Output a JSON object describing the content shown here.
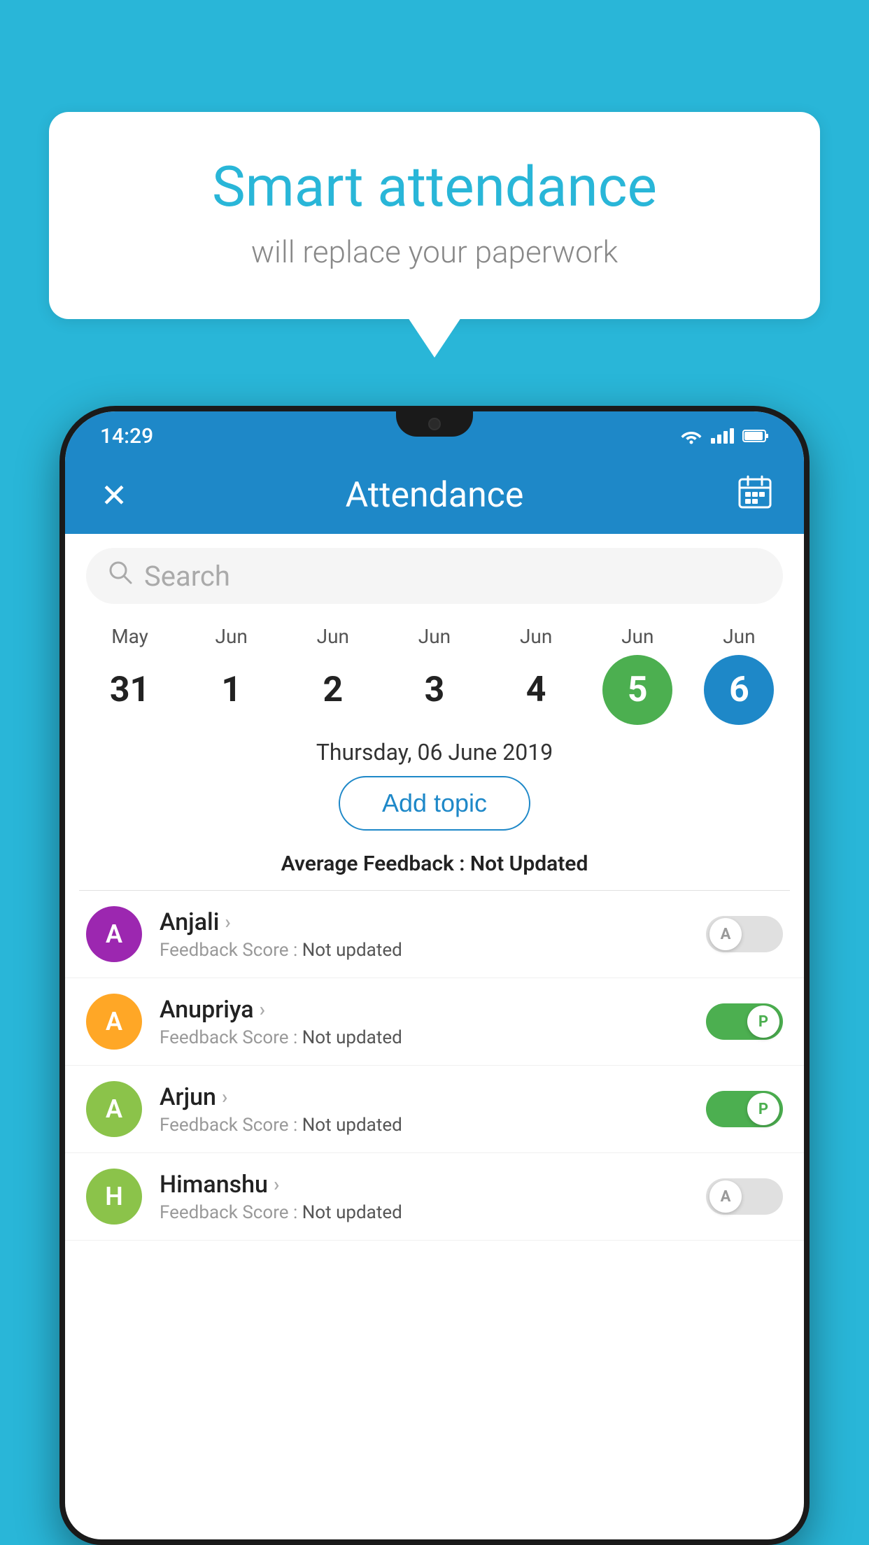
{
  "background_color": "#29b6d8",
  "speech_bubble": {
    "title": "Smart attendance",
    "subtitle": "will replace your paperwork"
  },
  "status_bar": {
    "time": "14:29",
    "icons": [
      "wifi",
      "signal",
      "battery"
    ]
  },
  "app_bar": {
    "close_icon": "✕",
    "title": "Attendance",
    "calendar_icon": "📅"
  },
  "search": {
    "placeholder": "Search"
  },
  "dates": [
    {
      "month": "May",
      "day": "31",
      "style": "normal"
    },
    {
      "month": "Jun",
      "day": "1",
      "style": "normal"
    },
    {
      "month": "Jun",
      "day": "2",
      "style": "normal"
    },
    {
      "month": "Jun",
      "day": "3",
      "style": "normal"
    },
    {
      "month": "Jun",
      "day": "4",
      "style": "normal"
    },
    {
      "month": "Jun",
      "day": "5",
      "style": "today"
    },
    {
      "month": "Jun",
      "day": "6",
      "style": "selected"
    }
  ],
  "selected_date_label": "Thursday, 06 June 2019",
  "add_topic_label": "Add topic",
  "avg_feedback": {
    "label": "Average Feedback : ",
    "value": "Not Updated"
  },
  "students": [
    {
      "name": "Anjali",
      "avatar_letter": "A",
      "avatar_color": "#9c27b0",
      "feedback_label": "Feedback Score : ",
      "feedback_value": "Not updated",
      "toggle_state": "off",
      "toggle_label": "A"
    },
    {
      "name": "Anupriya",
      "avatar_letter": "A",
      "avatar_color": "#ffa726",
      "feedback_label": "Feedback Score : ",
      "feedback_value": "Not updated",
      "toggle_state": "on",
      "toggle_label": "P"
    },
    {
      "name": "Arjun",
      "avatar_letter": "A",
      "avatar_color": "#8bc34a",
      "feedback_label": "Feedback Score : ",
      "feedback_value": "Not updated",
      "toggle_state": "on",
      "toggle_label": "P"
    },
    {
      "name": "Himanshu",
      "avatar_letter": "H",
      "avatar_color": "#8bc34a",
      "feedback_label": "Feedback Score : ",
      "feedback_value": "Not updated",
      "toggle_state": "off",
      "toggle_label": "A"
    }
  ]
}
